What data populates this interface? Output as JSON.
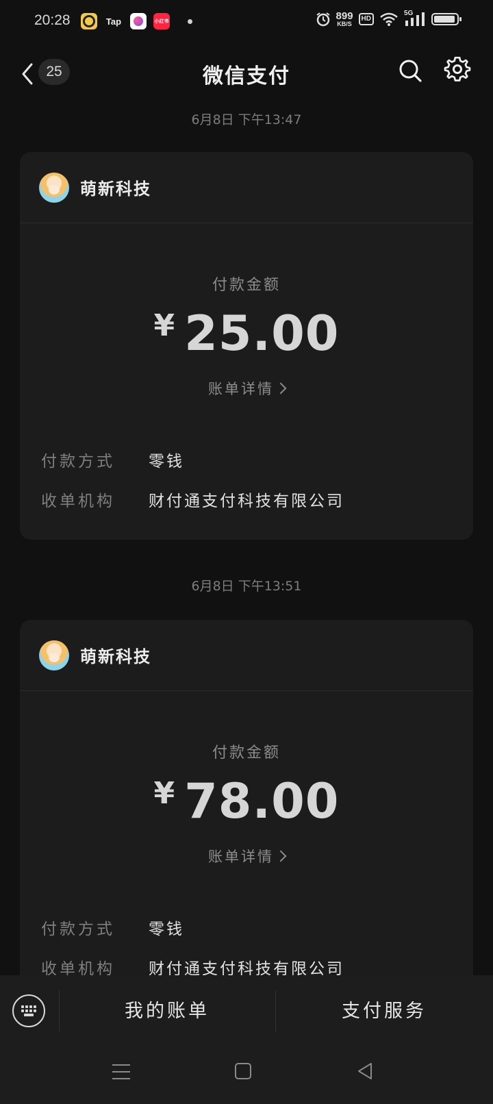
{
  "status_bar": {
    "time": "20:28",
    "app_icons": [
      "music-app-icon",
      "taptap-icon",
      "photo-app-icon",
      "xiaohongshu-icon"
    ],
    "tap_label": "Tap",
    "xhs_label": "小红书",
    "net_speed": "899",
    "net_unit": "KB/S",
    "hd_label": "HD",
    "network_label": "5G"
  },
  "header": {
    "back_count": "25",
    "title": "微信支付"
  },
  "payments": [
    {
      "timestamp": "6月8日 下午13:47",
      "merchant": "萌新科技",
      "amount_label": "付款金额",
      "currency": "¥",
      "amount": "25.00",
      "detail_link": "账单详情",
      "method_label": "付款方式",
      "method_value": "零钱",
      "acquirer_label": "收单机构",
      "acquirer_value": "财付通支付科技有限公司"
    },
    {
      "timestamp": "6月8日 下午13:51",
      "merchant": "萌新科技",
      "amount_label": "付款金额",
      "currency": "¥",
      "amount": "78.00",
      "detail_link": "账单详情",
      "method_label": "付款方式",
      "method_value": "零钱",
      "acquirer_label": "收单机构",
      "acquirer_value": "财付通支付科技有限公司"
    }
  ],
  "bottom_bar": {
    "my_bills": "我的账单",
    "pay_services": "支付服务"
  },
  "colors": {
    "background": "#111111",
    "card": "#1c1c1c",
    "bar": "#1d1d1d"
  }
}
